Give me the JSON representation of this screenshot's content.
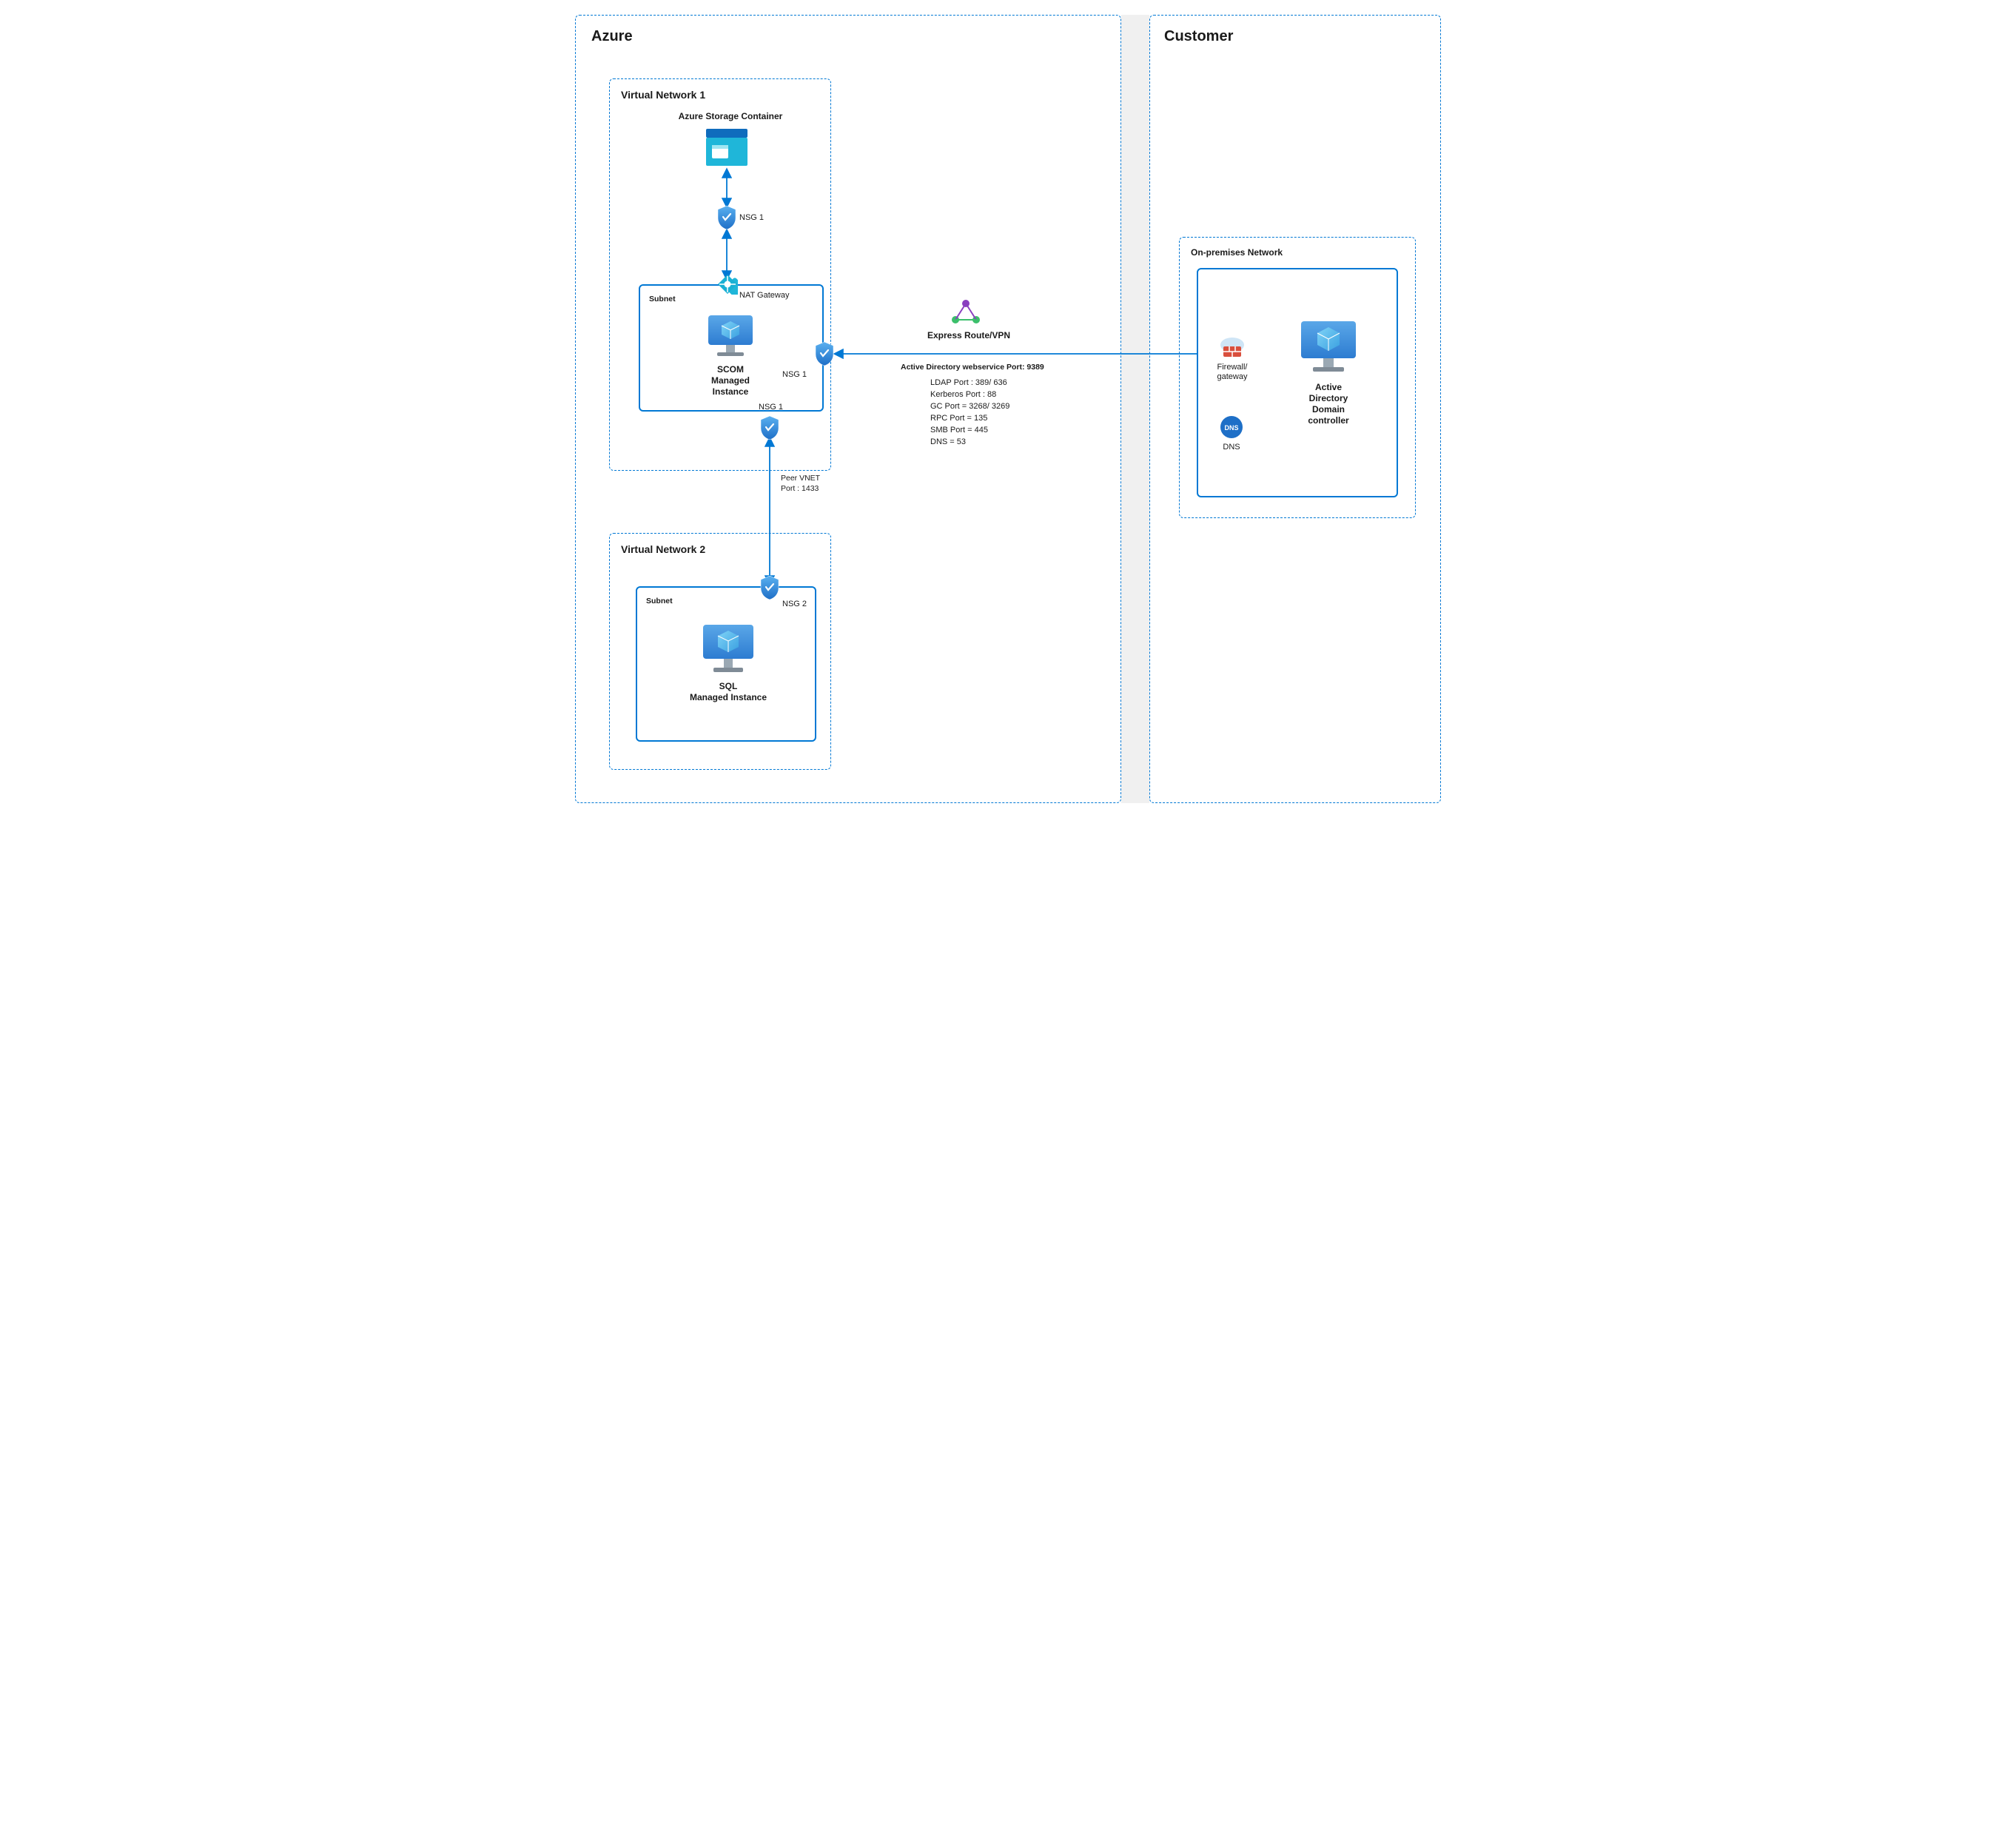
{
  "azure": {
    "title": "Azure",
    "vnet1": {
      "title": "Virtual Network 1",
      "storage_label": "Azure Storage Container",
      "nsg1": "NSG 1",
      "nat_gateway": "NAT Gateway",
      "subnet_label": "Subnet",
      "scom_label1": "SCOM",
      "scom_label2": "Managed Instance",
      "nsg1_right": "NSG 1",
      "nsg1_bottom": "NSG 1"
    },
    "vnet2": {
      "title": "Virtual Network 2",
      "subnet_label": "Subnet",
      "nsg2": "NSG 2",
      "sql_label1": "SQL",
      "sql_label2": "Managed Instance"
    },
    "peer": {
      "line1": "Peer VNET",
      "line2": "Port : 1433"
    }
  },
  "center": {
    "route_title": "Express Route/VPN",
    "ad_ws": "Active Directory webservice Port: 9389",
    "ports": [
      "LDAP Port : 389/ 636",
      "Kerberos Port : 88",
      "GC Port = 3268/ 3269",
      "RPC Port = 135",
      "SMB Port = 445",
      "DNS = 53"
    ]
  },
  "customer": {
    "title": "Customer",
    "onprem_title": "On-premises Network",
    "firewall": "Firewall/\ngateway",
    "dns": "DNS",
    "ad_label1": "Active",
    "ad_label2": "Directory",
    "ad_label3": "Domain",
    "ad_label4": "controller"
  },
  "colors": {
    "azure_blue": "#0078d4",
    "shield_blue": "#3a8fde",
    "storage_teal": "#00b7c3",
    "monitor_blue": "#3b8ede",
    "cube_light": "#50b0e8"
  }
}
